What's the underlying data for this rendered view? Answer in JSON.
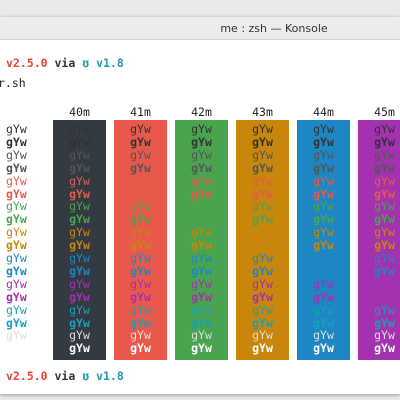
{
  "window": {
    "title": "me : zsh — Konsole"
  },
  "prompt": {
    "version": "v2.5.0",
    "via": "via",
    "go_icon": "gopher-icon",
    "go_version": "v1.8"
  },
  "script_name": "r.sh",
  "sample_text": "gYw",
  "colors": {
    "page_bg": "#e9e9e9",
    "terminal_bg": "#ffffff",
    "black": "#333a42",
    "red": "#e8594c",
    "green": "#4aa34f",
    "yellow": "#c8860a",
    "blue": "#1d87c3",
    "magenta": "#a232ad",
    "cyan": "#17a1b8",
    "gray": "#c8c8c8",
    "dark_fg": "#333333",
    "white_fg": "#ffffff"
  },
  "columns": [
    {
      "label": "",
      "bg": "none"
    },
    {
      "label": "40m",
      "bg": "#333a42"
    },
    {
      "label": "41m",
      "bg": "#e8594c"
    },
    {
      "label": "42m",
      "bg": "#4aa34f"
    },
    {
      "label": "43m",
      "bg": "#c8860a"
    },
    {
      "label": "44m",
      "bg": "#1d87c3"
    },
    {
      "label": "45m",
      "bg": "#a232ad"
    }
  ],
  "rows": [
    {
      "fg": "#333333",
      "bold": false
    },
    {
      "fg": "#333333",
      "bold": true
    },
    {
      "fg": "#555555",
      "bold": false
    },
    {
      "fg": "#555555",
      "bold": true
    },
    {
      "fg": "#e8594c",
      "bold": false
    },
    {
      "fg": "#e8594c",
      "bold": true
    },
    {
      "fg": "#4aa34f",
      "bold": false
    },
    {
      "fg": "#4aa34f",
      "bold": true
    },
    {
      "fg": "#c8860a",
      "bold": false
    },
    {
      "fg": "#c8860a",
      "bold": true
    },
    {
      "fg": "#1d87c3",
      "bold": false
    },
    {
      "fg": "#1d87c3",
      "bold": true
    },
    {
      "fg": "#a232ad",
      "bold": false
    },
    {
      "fg": "#a232ad",
      "bold": true
    },
    {
      "fg": "#17a1b8",
      "bold": false
    },
    {
      "fg": "#17a1b8",
      "bold": true
    },
    {
      "fg": "#dddddd",
      "bold": false
    },
    {
      "fg": "#ffffff",
      "bold": true
    }
  ]
}
